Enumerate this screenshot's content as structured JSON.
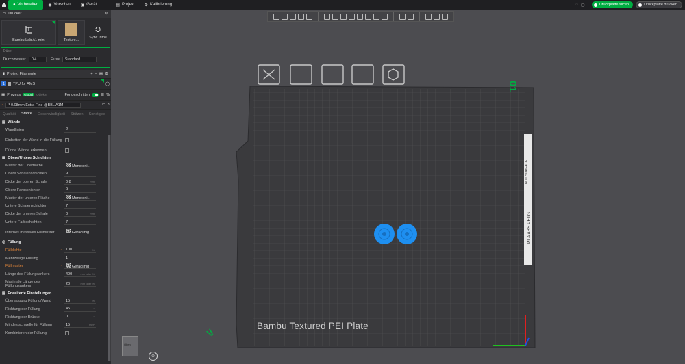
{
  "topbar": {
    "tabs": [
      "Vorbereiten",
      "Vorschau",
      "Gerät",
      "Projekt",
      "Kalibrierung"
    ],
    "slice_button": "Druckplatte slicen",
    "print_button": "Druckplatte drucken"
  },
  "sidebar": {
    "printer_header": "Drucker",
    "printer_name": "Bambu Lab A1 mini",
    "texture_label": "Texture...",
    "sync_label": "Sync Infos",
    "nozzle": {
      "title": "Düse",
      "diameter_label": "Durchmesser",
      "diameter_value": "0.4",
      "flow_label": "Fluss",
      "flow_value": "Standard"
    },
    "filament_header": "Projekt Filamente",
    "filament": {
      "index": "1",
      "name": "TPU for AMS"
    },
    "process": {
      "label": "Prozess",
      "global": "Global",
      "objects": "Objekte",
      "advanced": "Fortgeschritten",
      "preset": "* 0.08mm Extra Fine @BBL A1M"
    },
    "tabs": [
      "Qualität",
      "Stärke",
      "Geschwindigkeit",
      "Stützen",
      "Sonstiges"
    ],
    "sections": {
      "walls": "Wände",
      "topbottom": "Obere/Untere Schichten",
      "infill": "Füllung",
      "advanced": "Erweiterte Einstellungen"
    },
    "walls": [
      {
        "label": "Wandlinien",
        "value": "2"
      },
      {
        "label": "Einbetten der Wand in die Füllung"
      },
      {
        "label": "Dünne Wände erkennen"
      }
    ],
    "topbottom": [
      {
        "label": "Muster der Oberfläche",
        "value": "Monotoni..."
      },
      {
        "label": "Obere Schalenschichten",
        "value": "9"
      },
      {
        "label": "Dicke der oberen Schale",
        "value": "0.8",
        "unit": "mm"
      },
      {
        "label": "Obere Farbschichten",
        "value": "9"
      },
      {
        "label": "Muster der unteren Fläche",
        "value": "Monotoni..."
      },
      {
        "label": "Untere Schalenschichten",
        "value": "7"
      },
      {
        "label": "Dicke der unteren Schale",
        "value": "0",
        "unit": "mm"
      },
      {
        "label": "Untere Farbschichten",
        "value": "7"
      },
      {
        "label": "Internes massives Füllmuster",
        "value": "Geradlinig"
      }
    ],
    "infill": [
      {
        "label": "Fülldichte",
        "value": "100",
        "unit": "%"
      },
      {
        "label": "Mehrzeilige Füllung",
        "value": "1"
      },
      {
        "label": "Füllmuster",
        "value": "Geradlinig"
      },
      {
        "label": "Länge des Füllungsankers",
        "value": "400",
        "unit": "mm oder %"
      },
      {
        "label": "Maximale Länge des Füllungsankers",
        "value": "20",
        "unit": "mm oder %"
      }
    ],
    "advanced": [
      {
        "label": "Überlappung Füllung/Wand",
        "value": "15",
        "unit": "%"
      },
      {
        "label": "Richtung der Füllung",
        "value": "45",
        "unit": "°"
      },
      {
        "label": "Richtung der Brücke",
        "value": "0",
        "unit": "°"
      },
      {
        "label": "Mindestschwelle für Füllung",
        "value": "15",
        "unit": "mm²"
      },
      {
        "label": "Kombinieren der Füllung"
      }
    ]
  },
  "viewport": {
    "plate_label": "Bambu Textured PEI Plate",
    "plate_number": "01",
    "nav_cube_label": "Oben",
    "side_text": "PLA ABS PETG",
    "side_text2": "NOT SURFACE",
    "colors": {
      "model": "#1e8ff0",
      "accent": "#00ae42"
    }
  }
}
